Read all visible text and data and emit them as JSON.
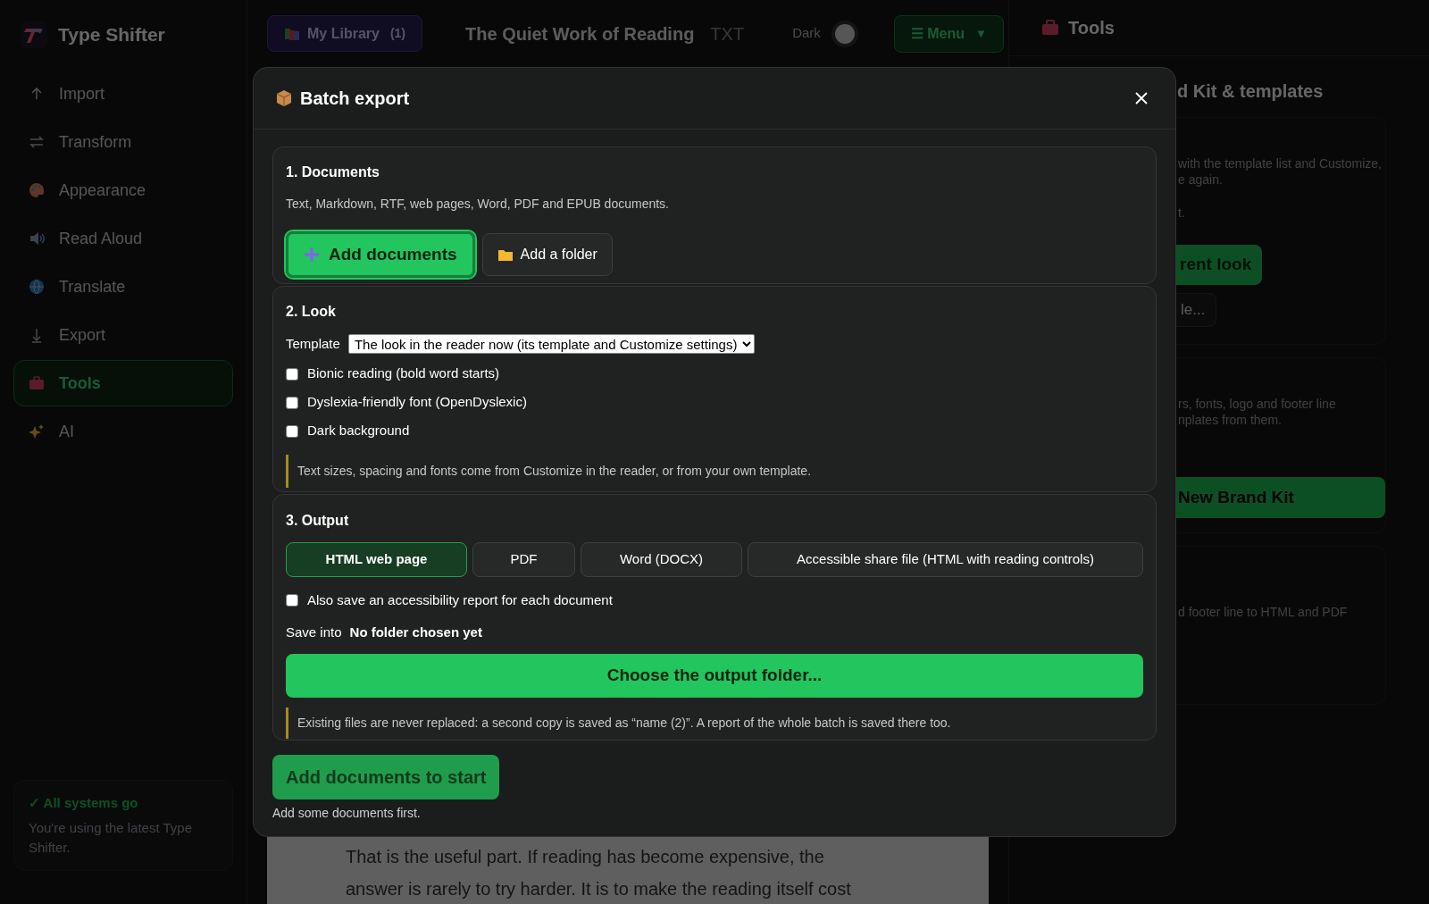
{
  "app": {
    "name": "Type Shifter"
  },
  "sidebar": {
    "items": [
      {
        "label": "Import",
        "selected": false
      },
      {
        "label": "Transform",
        "selected": false
      },
      {
        "label": "Appearance",
        "selected": false
      },
      {
        "label": "Read Aloud",
        "selected": false
      },
      {
        "label": "Translate",
        "selected": false
      },
      {
        "label": "Export",
        "selected": false
      },
      {
        "label": "Tools",
        "selected": true
      },
      {
        "label": "AI",
        "selected": false
      }
    ],
    "status": {
      "title": "✓ All systems go",
      "text": "You're using the latest Type Shifter."
    }
  },
  "header": {
    "library": {
      "label": "My Library",
      "count": "(1)"
    },
    "document_title": "The Quiet Work of Reading",
    "format": "TXT",
    "dark_toggle": {
      "label": "Dark",
      "on": false
    },
    "menu": {
      "label": "☰ Menu",
      "caret": "▼"
    }
  },
  "reader": {
    "lines": [
      "That is the useful part. If reading has become expensive, the",
      "answer is rarely to try harder. It is to make the reading itself cost"
    ]
  },
  "right_panel": {
    "title": "Tools",
    "heading": "d Kit & templates",
    "cards": [
      {
        "lines": [
          "with the template list and Customize,",
          "e again."
        ],
        "note": "t.",
        "buttons": [
          {
            "label": "rent look",
            "kind": "primary"
          },
          {
            "label": "le...",
            "kind": "secondary"
          }
        ]
      },
      {
        "lines": [
          "rs, fonts, logo and footer line",
          "nplates from them."
        ],
        "buttons": [
          {
            "label": "New Brand Kit",
            "kind": "wide"
          }
        ]
      },
      {
        "lines": [
          "d footer line to HTML and PDF"
        ]
      }
    ]
  },
  "dialog": {
    "title": "Batch export",
    "documents": {
      "heading": "1. Documents",
      "description": "Text, Markdown, RTF, web pages, Word, PDF and EPUB documents.",
      "add_button": "Add documents",
      "folder_button": "Add a folder"
    },
    "look": {
      "heading": "2. Look",
      "template_label": "Template",
      "template_value": "The look in the reader now (its template and Customize settings)",
      "options": [
        {
          "label": "Bionic reading (bold word starts)",
          "checked": false
        },
        {
          "label": "Dyslexia-friendly font (OpenDyslexic)",
          "checked": false
        },
        {
          "label": "Dark background",
          "checked": false
        }
      ],
      "note": "Text sizes, spacing and fonts come from Customize in the reader, or from your own template."
    },
    "output": {
      "heading": "3. Output",
      "formats": [
        {
          "label": "HTML web page",
          "selected": true
        },
        {
          "label": "PDF",
          "selected": false
        },
        {
          "label": "Word (DOCX)",
          "selected": false
        },
        {
          "label": "Accessible share file (HTML with reading controls)",
          "selected": false
        }
      ],
      "report_option": {
        "label": "Also save an accessibility report for each document",
        "checked": false
      },
      "save_into_label": "Save into",
      "save_into_value": "No folder chosen yet",
      "choose_button": "Choose the output folder...",
      "note": "Existing files are never replaced: a second copy is saved as “name (2)”. A report of the whole batch is saved there too."
    },
    "start_button": "Add documents to start",
    "start_hint": "Add some documents first."
  }
}
